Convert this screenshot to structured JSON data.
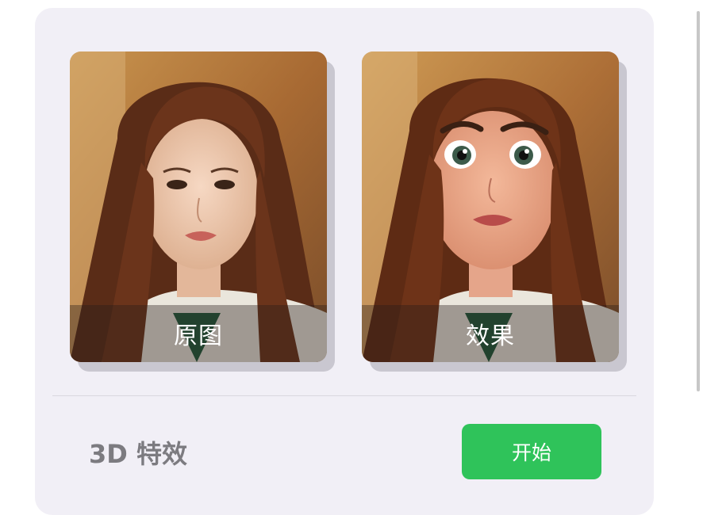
{
  "photos": {
    "original": {
      "label": "原图"
    },
    "result": {
      "label": "效果"
    }
  },
  "effect": {
    "title": "3D 特效",
    "start_label": "开始"
  },
  "colors": {
    "card_background": "#f1eff6",
    "start_button": "#2fc35a",
    "title_text": "#7c7b80"
  }
}
